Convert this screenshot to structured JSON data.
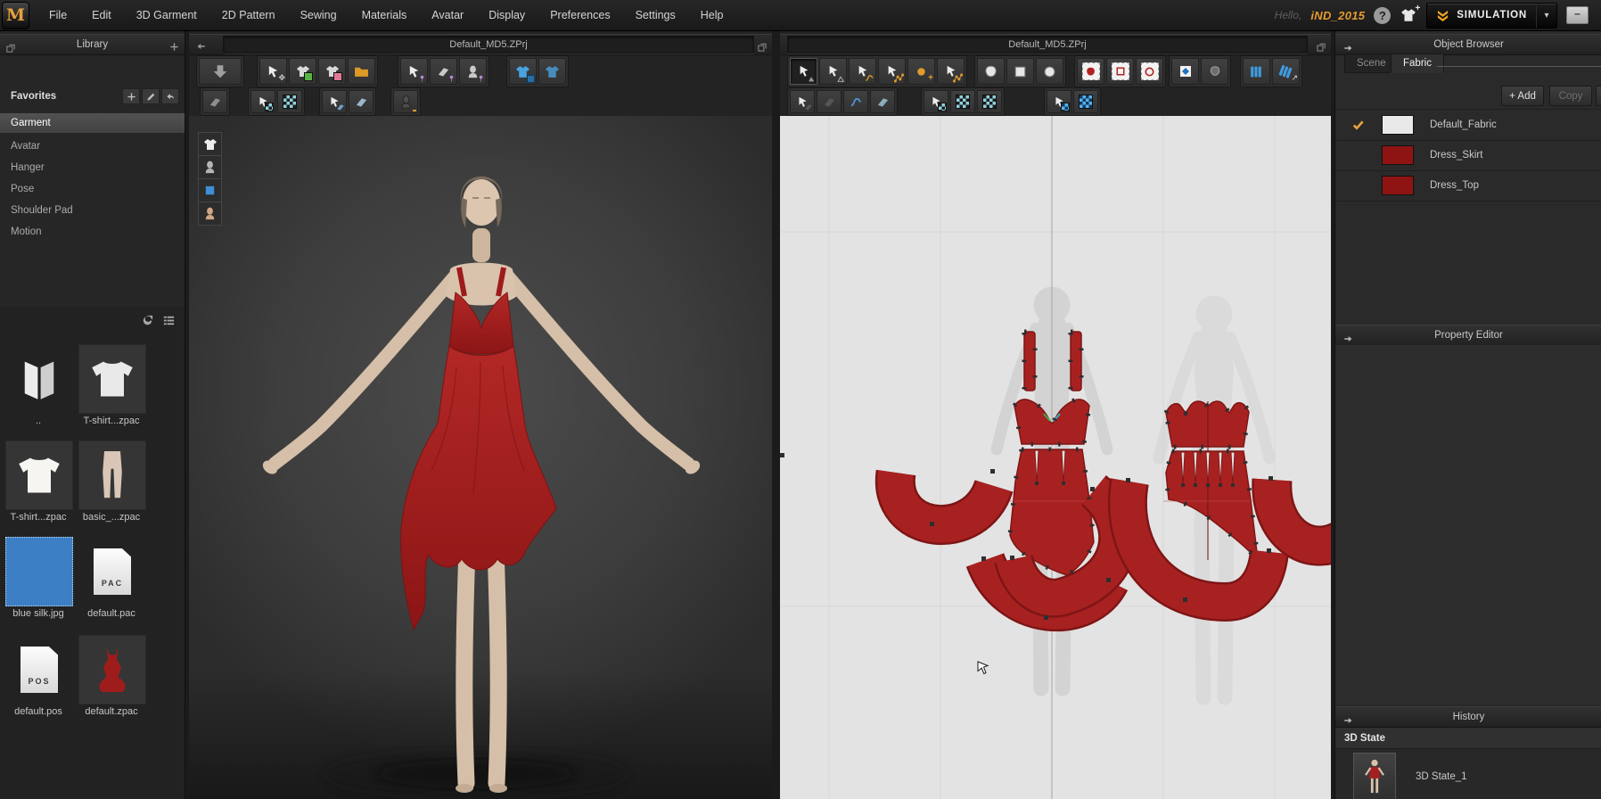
{
  "app": {
    "logo_letter": "M"
  },
  "menu": {
    "items": [
      "File",
      "Edit",
      "3D Garment",
      "2D Pattern",
      "Sewing",
      "Materials",
      "Avatar",
      "Display",
      "Preferences",
      "Settings",
      "Help"
    ]
  },
  "account": {
    "greeting": "Hello,",
    "username": "iND_2015"
  },
  "simulation": {
    "label": "SIMULATION"
  },
  "icons": {
    "help_glyph": "?",
    "dropdown_glyph": "▾",
    "minimize_glyph": "–"
  },
  "library": {
    "title": "Library",
    "favorites_label": "Favorites",
    "categories": [
      "Garment",
      "Avatar",
      "Hanger",
      "Pose",
      "Shoulder Pad",
      "Motion"
    ],
    "selected_category": "Garment",
    "items": [
      {
        "label": ".."
      },
      {
        "label": "T-shirt...zpac"
      },
      {
        "label": "T-shirt...zpac"
      },
      {
        "label": "basic_...zpac"
      },
      {
        "label": "blue silk.jpg"
      },
      {
        "label": "default.pac",
        "badge": "PAC"
      },
      {
        "label": "default.pos",
        "badge": "POS"
      },
      {
        "label": "default.zpac"
      }
    ]
  },
  "viewport_3d": {
    "title": "Default_MD5.ZPrj"
  },
  "viewport_2d": {
    "title": "Default_MD5.ZPrj"
  },
  "object_browser": {
    "title": "Object Browser",
    "tabs": [
      {
        "label": "Scene",
        "active": false
      },
      {
        "label": "Fabric",
        "active": true
      }
    ],
    "buttons": {
      "add": "+ Add",
      "copy": "Copy"
    },
    "fabrics": [
      {
        "name": "Default_Fabric",
        "swatch": "#e9e9e9",
        "checked": true
      },
      {
        "name": "Dress_Skirt",
        "swatch": "#8e1414",
        "checked": false
      },
      {
        "name": "Dress_Top",
        "swatch": "#8e1414",
        "checked": false
      }
    ]
  },
  "property_editor": {
    "title": "Property Editor"
  },
  "history": {
    "title": "History",
    "group": "3D State",
    "states": [
      {
        "label": "3D State_1"
      }
    ]
  },
  "colors": {
    "accent_orange": "#e89b2f",
    "pattern_red": "#a82121",
    "swatch_red": "#8e1414",
    "library_blue": "#3d7fc4",
    "icon_blue": "#4aa3e0"
  }
}
